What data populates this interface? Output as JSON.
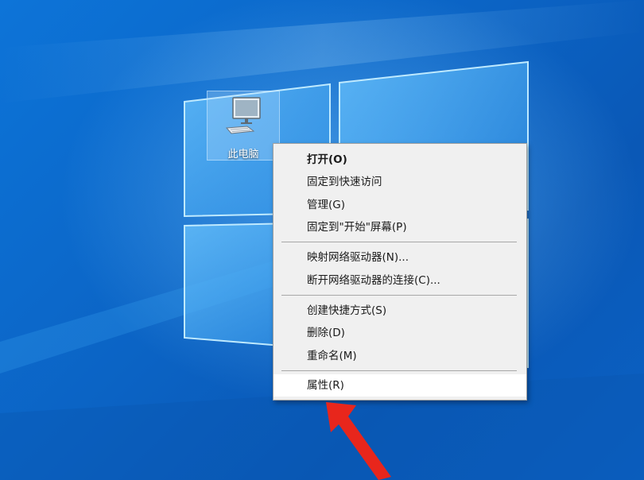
{
  "desktop": {
    "icon_label": "此电脑",
    "icon_name": "computer-icon"
  },
  "context_menu": {
    "items": [
      {
        "label": "打开(O)",
        "bold": true
      },
      {
        "label": "固定到快速访问"
      },
      {
        "label": "管理(G)"
      },
      {
        "label": "固定到\"开始\"屏幕(P)"
      },
      {
        "label": "映射网络驱动器(N)..."
      },
      {
        "label": "断开网络驱动器的连接(C)..."
      },
      {
        "label": "创建快捷方式(S)"
      },
      {
        "label": "删除(D)"
      },
      {
        "label": "重命名(M)"
      },
      {
        "label": "属性(R)",
        "highlighted": true
      }
    ]
  },
  "annotation": {
    "arrow_icon": "red-arrow-icon",
    "arrow_color": "#e8261c"
  },
  "colors": {
    "wallpaper_blue": "#0b63c4",
    "menu_bg": "#f0f0f0",
    "highlight_bg": "#ffffff"
  }
}
